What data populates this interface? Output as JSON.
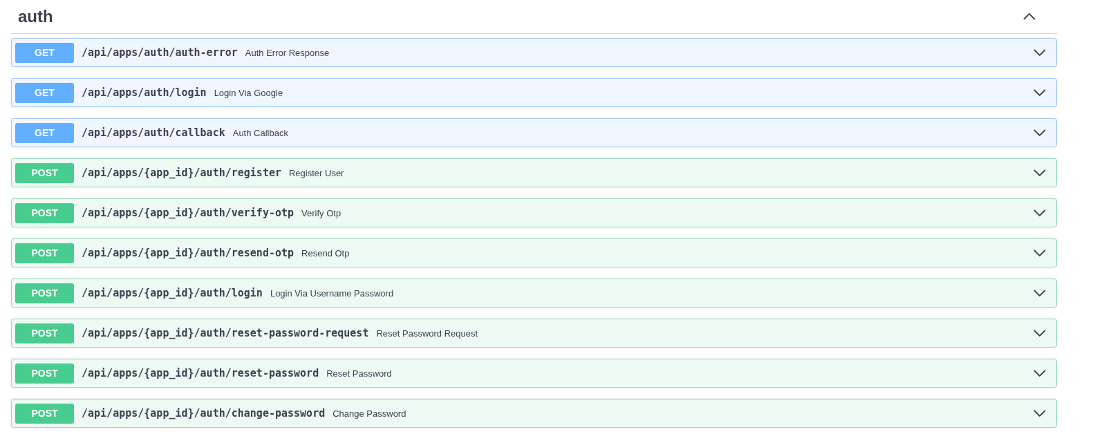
{
  "tag": {
    "title": "auth",
    "expanded": true
  },
  "operations": [
    {
      "kind": "get",
      "method": "GET",
      "path": "/api/apps/auth/auth-error",
      "summary": "Auth Error Response",
      "expanded": false
    },
    {
      "kind": "get",
      "method": "GET",
      "path": "/api/apps/auth/login",
      "summary": "Login Via Google",
      "expanded": false
    },
    {
      "kind": "get",
      "method": "GET",
      "path": "/api/apps/auth/callback",
      "summary": "Auth Callback",
      "expanded": false
    },
    {
      "kind": "post",
      "method": "POST",
      "path": "/api/apps/{app_id}/auth/register",
      "summary": "Register User",
      "expanded": false
    },
    {
      "kind": "post",
      "method": "POST",
      "path": "/api/apps/{app_id}/auth/verify-otp",
      "summary": "Verify Otp",
      "expanded": false
    },
    {
      "kind": "post",
      "method": "POST",
      "path": "/api/apps/{app_id}/auth/resend-otp",
      "summary": "Resend Otp",
      "expanded": false
    },
    {
      "kind": "post",
      "method": "POST",
      "path": "/api/apps/{app_id}/auth/login",
      "summary": "Login Via Username Password",
      "expanded": false
    },
    {
      "kind": "post",
      "method": "POST",
      "path": "/api/apps/{app_id}/auth/reset-password-request",
      "summary": "Reset Password Request",
      "expanded": false
    },
    {
      "kind": "post",
      "method": "POST",
      "path": "/api/apps/{app_id}/auth/reset-password",
      "summary": "Reset Password",
      "expanded": false
    },
    {
      "kind": "post",
      "method": "POST",
      "path": "/api/apps/{app_id}/auth/change-password",
      "summary": "Change Password",
      "expanded": false
    }
  ]
}
